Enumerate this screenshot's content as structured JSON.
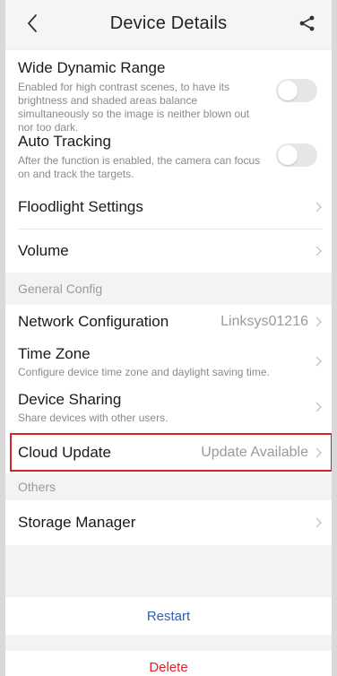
{
  "header": {
    "title": "Device Details",
    "back_icon": "chevron-left-icon",
    "share_icon": "share-icon"
  },
  "settings": {
    "wdr": {
      "label": "Wide Dynamic Range",
      "description": "Enabled for high contrast scenes, to have its brightness and shaded areas balance simultaneously so the image is neither blown out nor too dark.",
      "enabled": false
    },
    "auto_tracking": {
      "label": "Auto Tracking",
      "description": "After the function is enabled, the camera can focus on and track the targets.",
      "enabled": false
    },
    "floodlight": {
      "label": "Floodlight Settings"
    },
    "volume": {
      "label": "Volume"
    }
  },
  "general_config": {
    "group_label": "General Config",
    "network": {
      "label": "Network Configuration",
      "value": "Linksys01216"
    },
    "time_zone": {
      "label": "Time Zone",
      "description": "Configure device time zone and daylight saving time."
    },
    "device_sharing": {
      "label": "Device Sharing",
      "description": "Share devices with other users."
    },
    "cloud_update": {
      "label": "Cloud Update",
      "value": "Update Available"
    }
  },
  "others": {
    "group_label": "Others",
    "storage": {
      "label": "Storage Manager"
    }
  },
  "actions": {
    "restart": "Restart",
    "delete": "Delete"
  },
  "colors": {
    "restart": "#2f5fb3",
    "delete": "#d9222a",
    "highlight": "#d9222a"
  }
}
